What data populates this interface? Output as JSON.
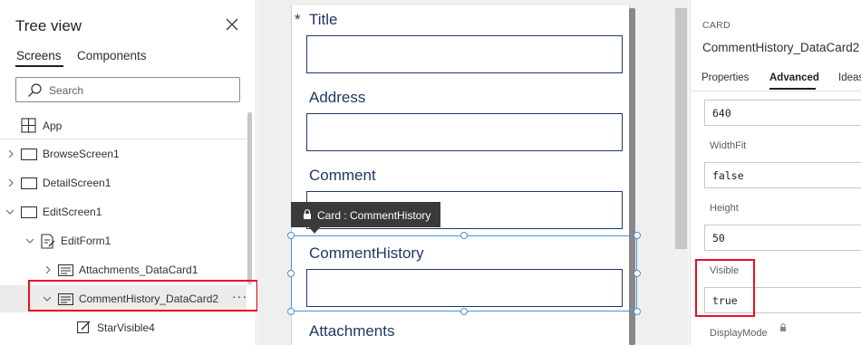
{
  "tree": {
    "title": "Tree view",
    "tabs": [
      "Screens",
      "Components"
    ],
    "search_placeholder": "Search",
    "items": [
      {
        "label": "App"
      },
      {
        "label": "BrowseScreen1"
      },
      {
        "label": "DetailScreen1"
      },
      {
        "label": "EditScreen1"
      },
      {
        "label": "EditForm1"
      },
      {
        "label": "Attachments_DataCard1"
      },
      {
        "label": "CommentHistory_DataCard2"
      },
      {
        "label": "StarVisible4"
      }
    ],
    "more": "···"
  },
  "form": {
    "required_mark": "*",
    "fields": [
      {
        "label": "Title"
      },
      {
        "label": "Address"
      },
      {
        "label": "Comment"
      },
      {
        "label": "CommentHistory"
      },
      {
        "label": "Attachments"
      }
    ],
    "tooltip": "Card : CommentHistory"
  },
  "props": {
    "kind": "CARD",
    "name": "CommentHistory_DataCard2",
    "tabs": [
      "Properties",
      "Advanced",
      "Ideas"
    ],
    "first_value": "640",
    "rows": [
      {
        "label": "WidthFit",
        "value": "false"
      },
      {
        "label": "Height",
        "value": "50"
      },
      {
        "label": "Visible",
        "value": "true"
      }
    ],
    "last_label": "DisplayMode"
  },
  "colors": {
    "highlight_red": "#e81123",
    "selection_blue": "#4a90d9",
    "field_border": "#1f3864"
  }
}
